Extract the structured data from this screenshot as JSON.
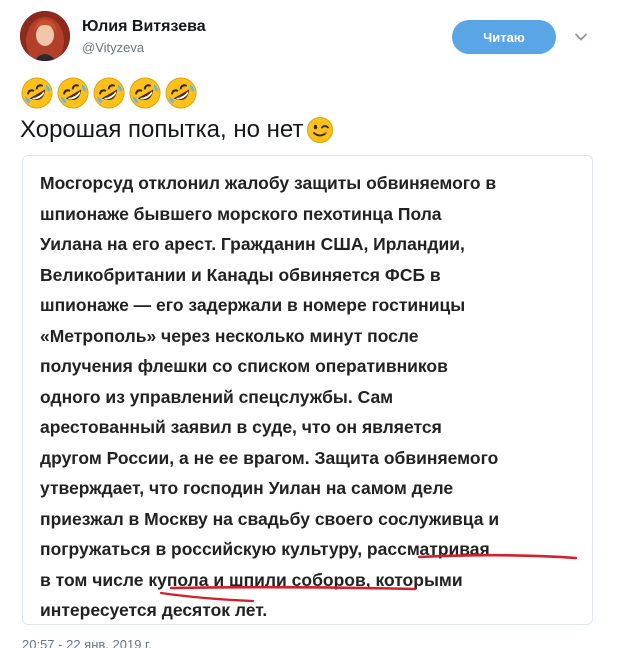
{
  "author": {
    "name": "Юлия Витязева",
    "handle": "@Vityzeva"
  },
  "follow_button": {
    "label": "Читаю"
  },
  "tweet": {
    "emojis": [
      "rolling-on-floor-laughing",
      "rolling-on-floor-laughing",
      "rolling-on-floor-laughing",
      "rolling-on-floor-laughing",
      "rolling-on-floor-laughing"
    ],
    "text": "Хорошая попытка, но нет",
    "trailing_emoji": "winking-face"
  },
  "quoted_card": {
    "lines": [
      "Мосгорсуд отклонил жалобу защиты обвиняемого в",
      "шпионаже бывшего морского пехотинца Пола",
      "Уилана на его арест. Гражданин США, Ирландии,",
      "Великобритании и Канады обвиняется ФСБ в",
      "шпионаже — его задержали в номере гостиницы",
      "«Метрополь» через несколько минут после",
      "получения флешки со списком оперативников",
      "одного из управлений спецслужбы. Сам",
      "арестованный заявил в суде, что он является",
      "другом России, а не ее врагом. Защита обвиняемого",
      "утверждает, что господин Уилан на самом деле",
      "приезжал в Москву на свадьбу своего сослуживца и",
      "погружаться в российскую культуру, рассматривая",
      "в том числе купола и шпили соборов, которыми",
      "интересуется десяток лет."
    ],
    "underline_color": "#d3202c"
  },
  "timestamp": "20:57 - 22 янв. 2019 г."
}
